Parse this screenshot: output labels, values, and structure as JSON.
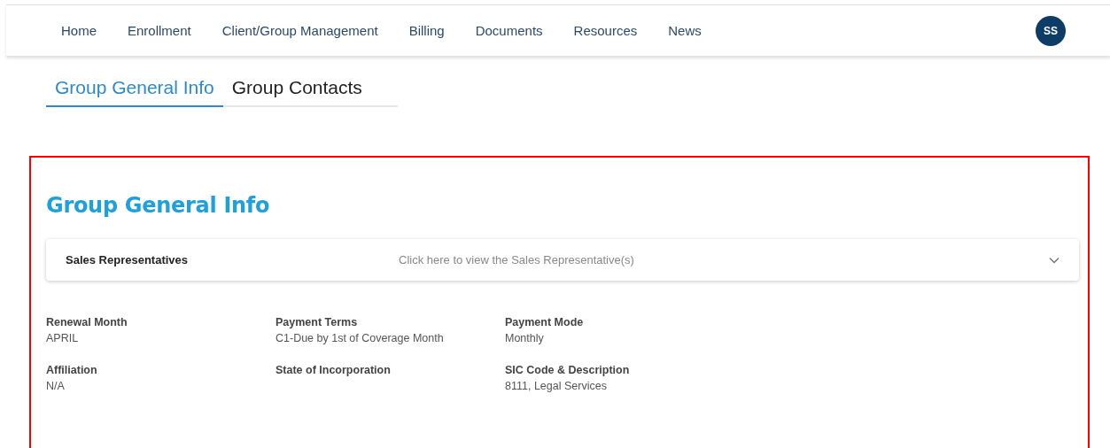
{
  "nav": {
    "items": [
      {
        "label": "Home"
      },
      {
        "label": "Enrollment"
      },
      {
        "label": "Client/Group Management"
      },
      {
        "label": "Billing"
      },
      {
        "label": "Documents"
      },
      {
        "label": "Resources"
      },
      {
        "label": "News"
      }
    ],
    "avatar": "SS"
  },
  "tabs": [
    {
      "label": "Group General Info",
      "selected": true
    },
    {
      "label": "Group Contacts",
      "selected": false
    }
  ],
  "section": {
    "title": "Group General Info",
    "accordion": {
      "title": "Sales Representatives",
      "hint": "Click here to view the Sales Representative(s)",
      "expanded": false
    },
    "fields": [
      {
        "label": "Renewal Month",
        "value": "APRIL"
      },
      {
        "label": "Payment Terms",
        "value": "C1-Due by 1st of Coverage Month"
      },
      {
        "label": "Payment Mode",
        "value": "Monthly"
      },
      {
        "label": "Affiliation",
        "value": "N/A"
      },
      {
        "label": "State of Incorporation"
      },
      {
        "label": "SIC Code & Description",
        "value": "8111, Legal Services"
      }
    ]
  }
}
